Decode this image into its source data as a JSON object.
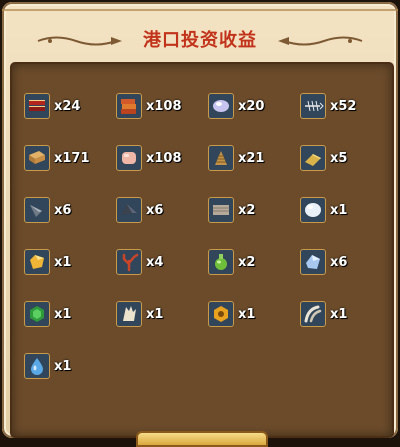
{
  "title": "港口投资收益",
  "colors": {
    "title": "#c1331a",
    "panel": "#6b4b2a",
    "frame": "#efdcb8",
    "icon_bg": "#31465a"
  },
  "items": [
    {
      "icon": "red-books-icon",
      "qty": "x24"
    },
    {
      "icon": "books-stack-icon",
      "qty": "x108"
    },
    {
      "icon": "purple-crystal-icon",
      "qty": "x20"
    },
    {
      "icon": "fish-bone-icon",
      "qty": "x52"
    },
    {
      "icon": "wood-planks-icon",
      "qty": "x171"
    },
    {
      "icon": "pink-stone-icon",
      "qty": "x108"
    },
    {
      "icon": "rope-coil-icon",
      "qty": "x21"
    },
    {
      "icon": "gold-bar-icon",
      "qty": "x5"
    },
    {
      "icon": "drill-bit-icon",
      "qty": "x6"
    },
    {
      "icon": "dark-ore-icon",
      "qty": "x6"
    },
    {
      "icon": "stone-slab-icon",
      "qty": "x2"
    },
    {
      "icon": "pearl-icon",
      "qty": "x1"
    },
    {
      "icon": "topaz-gem-icon",
      "qty": "x1"
    },
    {
      "icon": "coral-icon",
      "qty": "x4"
    },
    {
      "icon": "green-potion-icon",
      "qty": "x2"
    },
    {
      "icon": "blue-crystal-icon",
      "qty": "x6"
    },
    {
      "icon": "emerald-gem-icon",
      "qty": "x1"
    },
    {
      "icon": "white-leaf-icon",
      "qty": "x1"
    },
    {
      "icon": "gold-hexagon-icon",
      "qty": "x1"
    },
    {
      "icon": "tusk-icon",
      "qty": "x1"
    },
    {
      "icon": "water-drop-icon",
      "qty": "x1"
    }
  ]
}
